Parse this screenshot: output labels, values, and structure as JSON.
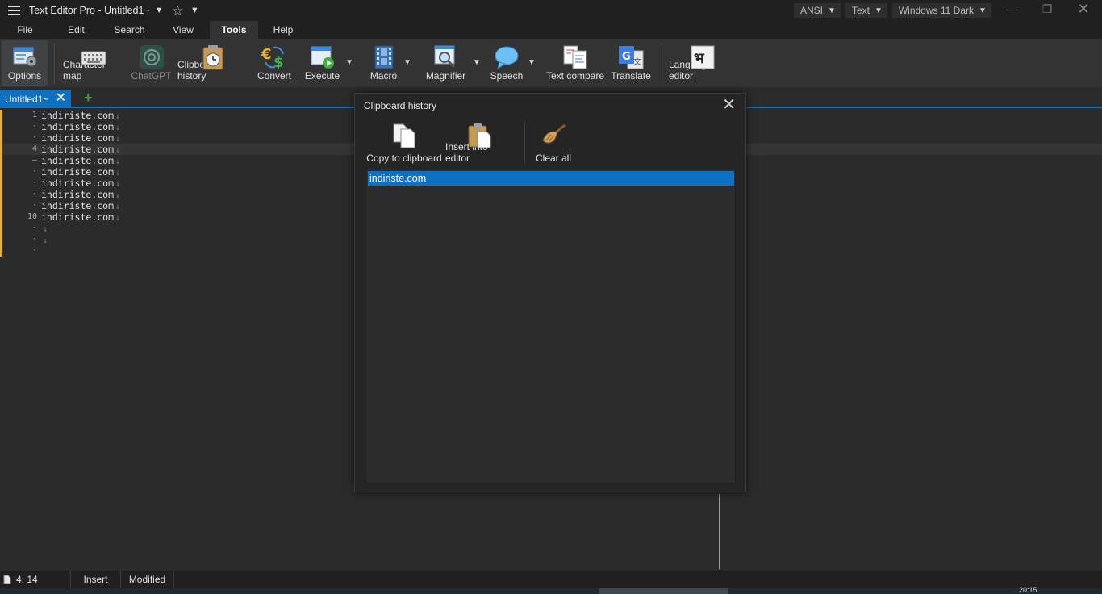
{
  "titlebar": {
    "app_title": "Text Editor Pro  -  Untitled1~",
    "encoding": "ANSI",
    "highlighter": "Text",
    "theme": "Windows 11 Dark"
  },
  "menu": {
    "items": [
      "File",
      "Edit",
      "Search",
      "View",
      "Tools",
      "Help"
    ],
    "active": "Tools"
  },
  "ribbon": {
    "options": "Options",
    "character_map": "Character map",
    "chatgpt": "ChatGPT",
    "clipboard_history": "Clipboard history",
    "convert": "Convert",
    "execute": "Execute",
    "macro": "Macro",
    "magnifier": "Magnifier",
    "speech": "Speech",
    "text_compare": "Text compare",
    "translate": "Translate",
    "language_editor": "Language editor"
  },
  "tabs": {
    "active_label": "Untitled1~"
  },
  "editor": {
    "lines": [
      {
        "num": "1",
        "text": "indiriste.com"
      },
      {
        "num": "·",
        "text": "indiriste.com"
      },
      {
        "num": "·",
        "text": "indiriste.com"
      },
      {
        "num": "4",
        "text": "indiriste.com"
      },
      {
        "num": "–",
        "text": "indiriste.com"
      },
      {
        "num": "·",
        "text": "indiriste.com"
      },
      {
        "num": "·",
        "text": "indiriste.com"
      },
      {
        "num": "·",
        "text": "indiriste.com"
      },
      {
        "num": "·",
        "text": "indiriste.com"
      },
      {
        "num": "10",
        "text": "indiriste.com"
      },
      {
        "num": "·",
        "text": ""
      },
      {
        "num": "·",
        "text": ""
      },
      {
        "num": "·",
        "text": ""
      }
    ],
    "current_line_index": 3
  },
  "dialog": {
    "title": "Clipboard history",
    "copy_to_clipboard": "Copy to clipboard",
    "insert_into_editor": "Insert into editor",
    "clear_all": "Clear all",
    "items": [
      "indiriste.com"
    ]
  },
  "statusbar": {
    "position": "4: 14",
    "mode": "Insert",
    "modified": "Modified"
  },
  "taskbar": {
    "clock": "20:15"
  }
}
